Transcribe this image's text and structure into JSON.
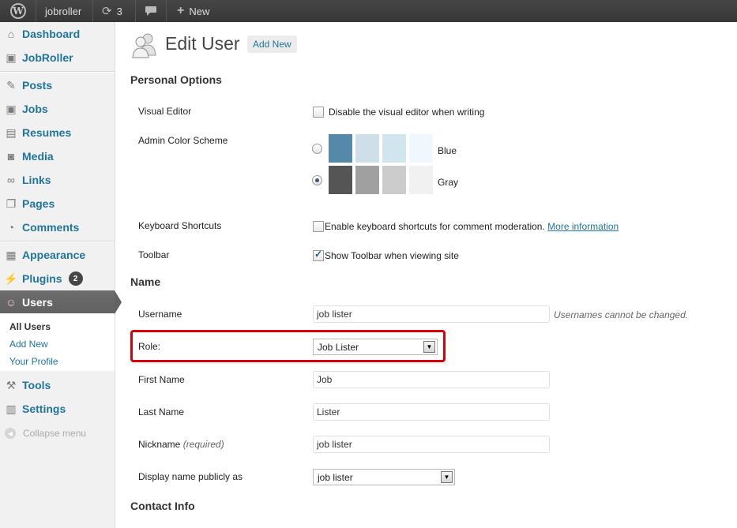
{
  "adminbar": {
    "wp_logo": "W",
    "site_name": "jobroller",
    "updates_count": "3",
    "new_label": "New",
    "icons": [
      "wordpress-icon",
      "refresh-icon",
      "comment-bubble-icon",
      "plus-icon"
    ]
  },
  "sidebar": {
    "items": [
      {
        "label": "Dashboard",
        "icon": "house-icon"
      },
      {
        "label": "JobRoller",
        "icon": "briefcase-icon"
      },
      {
        "label": "Posts",
        "icon": "pushpin-icon"
      },
      {
        "label": "Jobs",
        "icon": "briefcase-icon"
      },
      {
        "label": "Resumes",
        "icon": "id-card-icon"
      },
      {
        "label": "Media",
        "icon": "camera-icon"
      },
      {
        "label": "Links",
        "icon": "chain-link-icon"
      },
      {
        "label": "Pages",
        "icon": "page-icon"
      },
      {
        "label": "Comments",
        "icon": "comment-icon"
      },
      {
        "label": "Appearance",
        "icon": "window-icon"
      },
      {
        "label": "Plugins",
        "icon": "plug-icon",
        "badge": "2"
      },
      {
        "label": "Users",
        "icon": "users-icon"
      },
      {
        "label": "Tools",
        "icon": "tools-icon"
      },
      {
        "label": "Settings",
        "icon": "settings-icon"
      }
    ],
    "submenu": [
      "All Users",
      "Add New",
      "Your Profile"
    ],
    "collapse_label": "Collapse menu"
  },
  "page": {
    "title": "Edit User",
    "add_new": "Add New"
  },
  "personal_options": {
    "heading": "Personal Options",
    "visual_editor_label": "Visual Editor",
    "visual_editor_text": "Disable the visual editor when writing",
    "visual_editor_checked": false,
    "color_scheme_label": "Admin Color Scheme",
    "schemes": [
      {
        "name": "Blue",
        "selected": false,
        "colors": [
          "#5589aa",
          "#cfdfe9",
          "#d1e5ee",
          "#eff8ff"
        ]
      },
      {
        "name": "Gray",
        "selected": true,
        "colors": [
          "#555555",
          "#a0a0a0",
          "#cccccc",
          "#f1f1f1"
        ]
      }
    ],
    "keyboard_label": "Keyboard Shortcuts",
    "keyboard_text": "Enable keyboard shortcuts for comment moderation.",
    "keyboard_link": "More information",
    "keyboard_checked": false,
    "toolbar_label": "Toolbar",
    "toolbar_text": "Show Toolbar when viewing site",
    "toolbar_checked": true
  },
  "name": {
    "heading": "Name",
    "username_label": "Username",
    "username_value": "job lister",
    "username_hint": "Usernames cannot be changed.",
    "role_label": "Role:",
    "role_value": "Job Lister",
    "first_name_label": "First Name",
    "first_name_value": "Job",
    "last_name_label": "Last Name",
    "last_name_value": "Lister",
    "nickname_label": "Nickname",
    "nickname_required": "(required)",
    "nickname_value": "job lister",
    "display_label": "Display name publicly as",
    "display_value": "job lister"
  },
  "contact": {
    "heading": "Contact Info"
  },
  "colors": {
    "link": "#21759b",
    "highlight": "#d8000c",
    "adminbar": "#464646"
  }
}
